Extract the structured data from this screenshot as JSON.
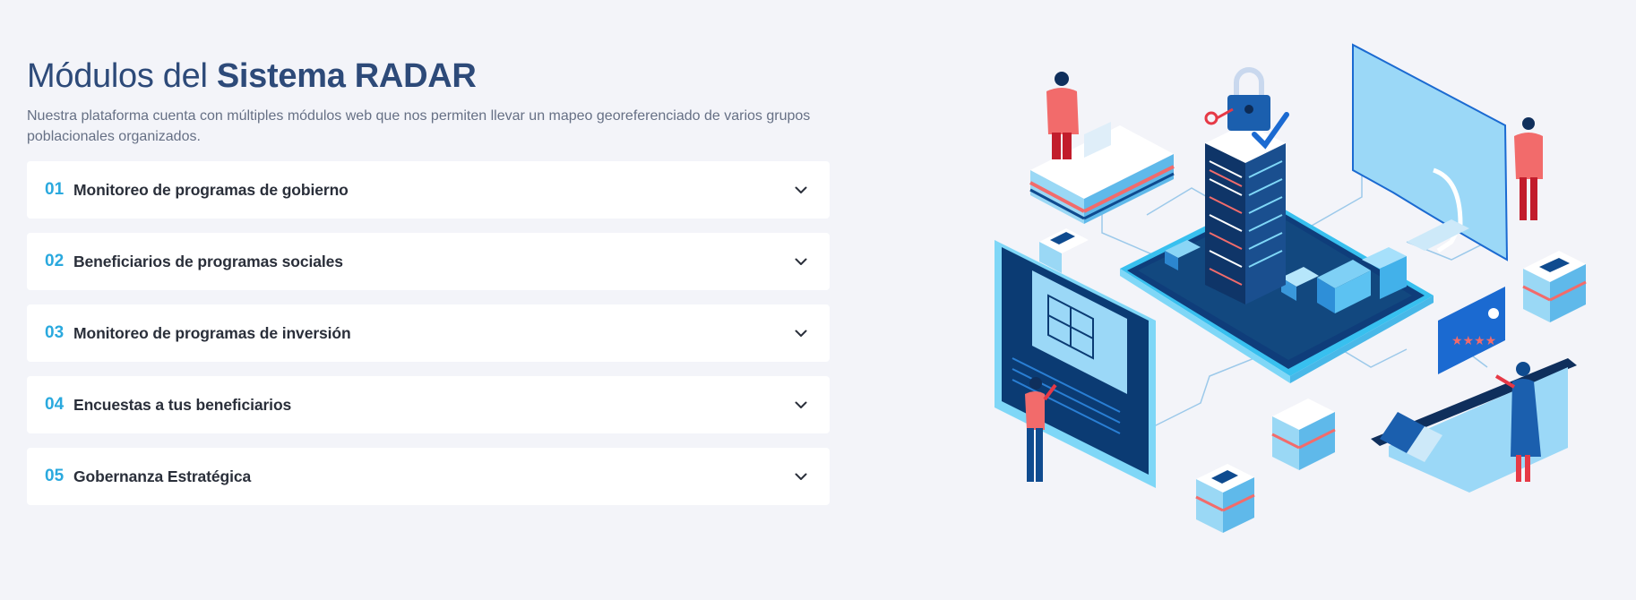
{
  "heading": {
    "light": "Módulos del",
    "bold": "Sistema RADAR"
  },
  "description": "Nuestra plataforma cuenta con múltiples módulos web que nos permiten llevar un mapeo georeferenciado de varios grupos poblacionales organizados.",
  "modules": [
    {
      "number": "01",
      "label": "Monitoreo de programas de gobierno"
    },
    {
      "number": "02",
      "label": "Beneficiarios de programas sociales"
    },
    {
      "number": "03",
      "label": "Monitoreo de programas de inversión"
    },
    {
      "number": "04",
      "label": "Encuestas a tus beneficiarios"
    },
    {
      "number": "05",
      "label": "Gobernanza Estratégica"
    }
  ],
  "illustration": {
    "rating_stars": "★★★★"
  },
  "colors": {
    "accent": "#2aa9de",
    "heading": "#2d4a79",
    "background": "#f3f4f9",
    "navy": "#0f4b8f",
    "coral": "#f26b6b",
    "sky": "#93d4f5"
  }
}
